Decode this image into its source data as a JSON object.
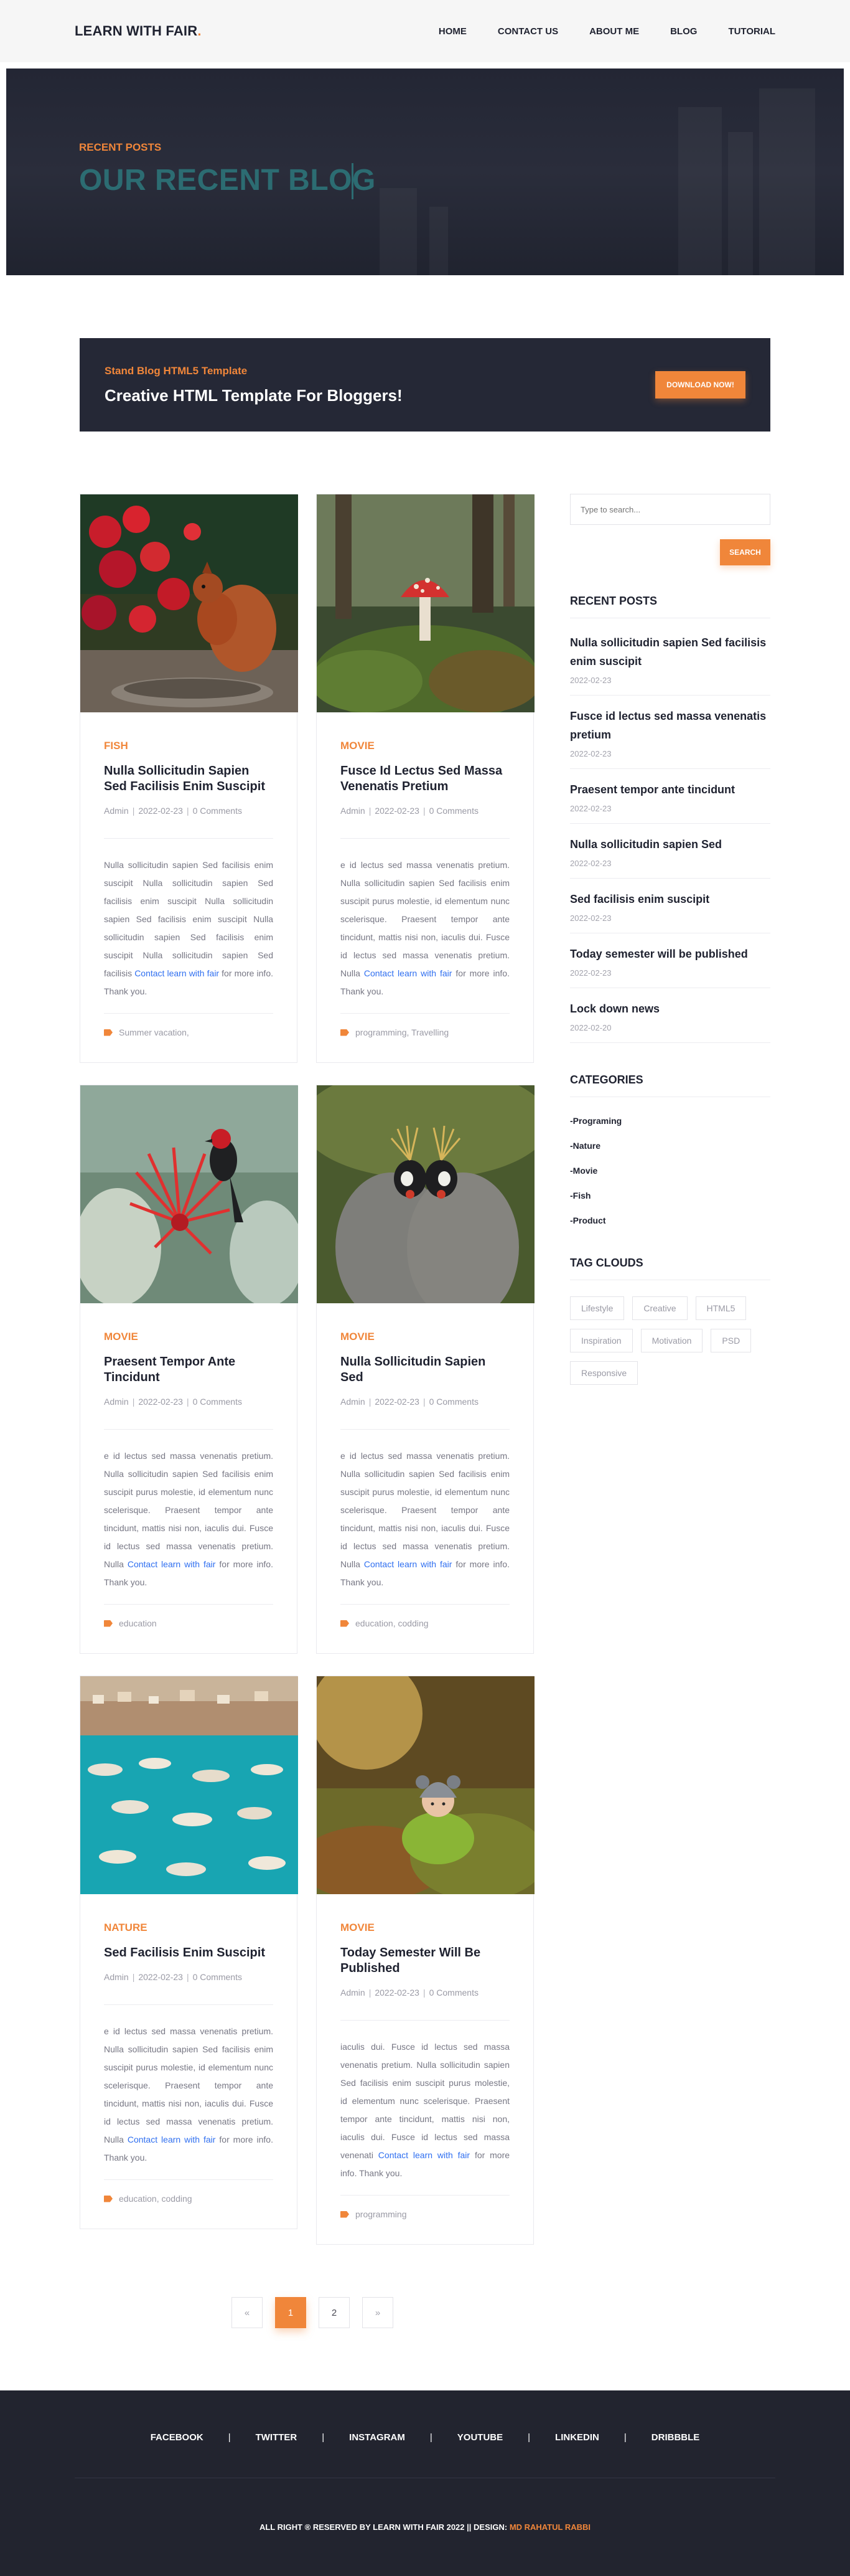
{
  "header": {
    "logo_text": "LEARN WITH FAIR",
    "logo_dot": ".",
    "nav": [
      "HOME",
      "CONTACT US",
      "ABOUT ME",
      "BLOG",
      "TUTORIAL"
    ]
  },
  "hero": {
    "kicker": "RECENT POSTS",
    "title": "OUR RECENT BLOG"
  },
  "banner": {
    "kicker": "Stand Blog HTML5 Template",
    "title": "Creative HTML Template For Bloggers!",
    "button": "DOWNLOAD NOW!"
  },
  "posts": [
    {
      "category": "FISH",
      "title": "Nulla Sollicitudin Sapien Sed Facilisis Enim Suscipit",
      "author": "Admin",
      "date": "2022-02-23",
      "comments": "0 Comments",
      "text": "Nulla sollicitudin sapien Sed facilisis enim suscipit Nulla sollicitudin sapien Sed facilisis enim suscipit Nulla sollicitudin sapien Sed facilisis enim suscipit Nulla sollicitudin sapien Sed facilisis enim suscipit Nulla sollicitudin sapien Sed facilisis",
      "link_text": "Contact learn with fair",
      "tail_text": "for more info. Thank you.",
      "tags": "Summer vacation,",
      "image": "red squirrel among red flowers"
    },
    {
      "category": "MOVIE",
      "title": "Fusce Id Lectus Sed Massa Venenatis Pretium",
      "author": "Admin",
      "date": "2022-02-23",
      "comments": "0 Comments",
      "text": "e id lectus sed massa venenatis pretium. Nulla sollicitudin sapien Sed facilisis enim suscipit purus molestie, id elementum nunc scelerisque. Praesent tempor ante tincidunt, mattis nisi non, iaculis dui. Fusce id lectus sed massa venenatis pretium. Nulla",
      "link_text": "Contact learn with fair",
      "tail_text": "for more info. Thank you.",
      "tags": "programming, Travelling",
      "image": "red mushroom in forest"
    },
    {
      "category": "MOVIE",
      "title": "Praesent Tempor Ante Tincidunt",
      "author": "Admin",
      "date": "2022-02-23",
      "comments": "0 Comments",
      "text": "e id lectus sed massa venenatis pretium. Nulla sollicitudin sapien Sed facilisis enim suscipit purus molestie, id elementum nunc scelerisque. Praesent tempor ante tincidunt, mattis nisi non, iaculis dui. Fusce id lectus sed massa venenatis pretium. Nulla",
      "link_text": "Contact learn with fair",
      "tail_text": "for more info. Thank you.",
      "tags": "education",
      "image": "bird on red flower"
    },
    {
      "category": "MOVIE",
      "title": "Nulla Sollicitudin Sapien Sed",
      "author": "Admin",
      "date": "2022-02-23",
      "comments": "0 Comments",
      "text": "e id lectus sed massa venenatis pretium. Nulla sollicitudin sapien Sed facilisis enim suscipit purus molestie, id elementum nunc scelerisque. Praesent tempor ante tincidunt, mattis nisi non, iaculis dui. Fusce id lectus sed massa venenatis pretium. Nulla",
      "link_text": "Contact learn with fair",
      "tail_text": "for more info. Thank you.",
      "tags": "education, codding",
      "image": "crowned cranes"
    },
    {
      "category": "NATURE",
      "title": "Sed Facilisis Enim Suscipit",
      "author": "Admin",
      "date": "2022-02-23",
      "comments": "0 Comments",
      "text": "e id lectus sed massa venenatis pretium. Nulla sollicitudin sapien Sed facilisis enim suscipit purus molestie, id elementum nunc scelerisque. Praesent tempor ante tincidunt, mattis nisi non, iaculis dui. Fusce id lectus sed massa venenatis pretium. Nulla",
      "link_text": "Contact learn with fair",
      "tail_text": "for more info. Thank you.",
      "tags": "education, codding",
      "image": "boats in turquoise harbor"
    },
    {
      "category": "MOVIE",
      "title": "Today Semester Will Be Published",
      "author": "Admin",
      "date": "2022-02-23",
      "comments": "0 Comments",
      "text": "iaculis dui. Fusce id lectus sed massa venenatis pretium. Nulla sollicitudin sapien Sed facilisis enim suscipit purus molestie, id elementum nunc scelerisque. Praesent tempor ante tincidunt, mattis nisi non, iaculis dui. Fusce id lectus sed massa venenati",
      "link_text": "Contact learn with fair",
      "tail_text": "for more info. Thank you.",
      "tags": "programming",
      "image": "child in knit hat on grass"
    }
  ],
  "sidebar": {
    "search_placeholder": "Type to search...",
    "search_button": "SEARCH",
    "recent_heading": "RECENT POSTS",
    "recent": [
      {
        "title": "Nulla sollicitudin sapien Sed facilisis enim suscipit",
        "date": "2022-02-23"
      },
      {
        "title": "Fusce id lectus sed massa venenatis pretium",
        "date": "2022-02-23"
      },
      {
        "title": "Praesent tempor ante tincidunt",
        "date": "2022-02-23"
      },
      {
        "title": "Nulla sollicitudin sapien Sed",
        "date": "2022-02-23"
      },
      {
        "title": "Sed facilisis enim suscipit",
        "date": "2022-02-23"
      },
      {
        "title": "Today semester will be published",
        "date": "2022-02-23"
      },
      {
        "title": "Lock down news",
        "date": "2022-02-20"
      }
    ],
    "categories_heading": "CATEGORIES",
    "categories": [
      "-Programing",
      "-Nature",
      "-Movie",
      "-Fish",
      "-Product"
    ],
    "tags_heading": "TAG CLOUDS",
    "tags": [
      "Lifestyle",
      "Creative",
      "HTML5",
      "Inspiration",
      "Motivation",
      "PSD",
      "Responsive"
    ]
  },
  "pagination": {
    "prev": "«",
    "pages": [
      "1",
      "2"
    ],
    "next": "»",
    "active": "1"
  },
  "footer": {
    "links": [
      "FACEBOOK",
      "TWITTER",
      "INSTAGRAM",
      "YOUTUBE",
      "LINKEDIN",
      "DRIBBBLE"
    ],
    "copyright": "ALL RIGHT ® RESERVED BY LEARN WITH FAIR 2022 || DESIGN:",
    "designer": "MD RAHATUL RABBI"
  }
}
